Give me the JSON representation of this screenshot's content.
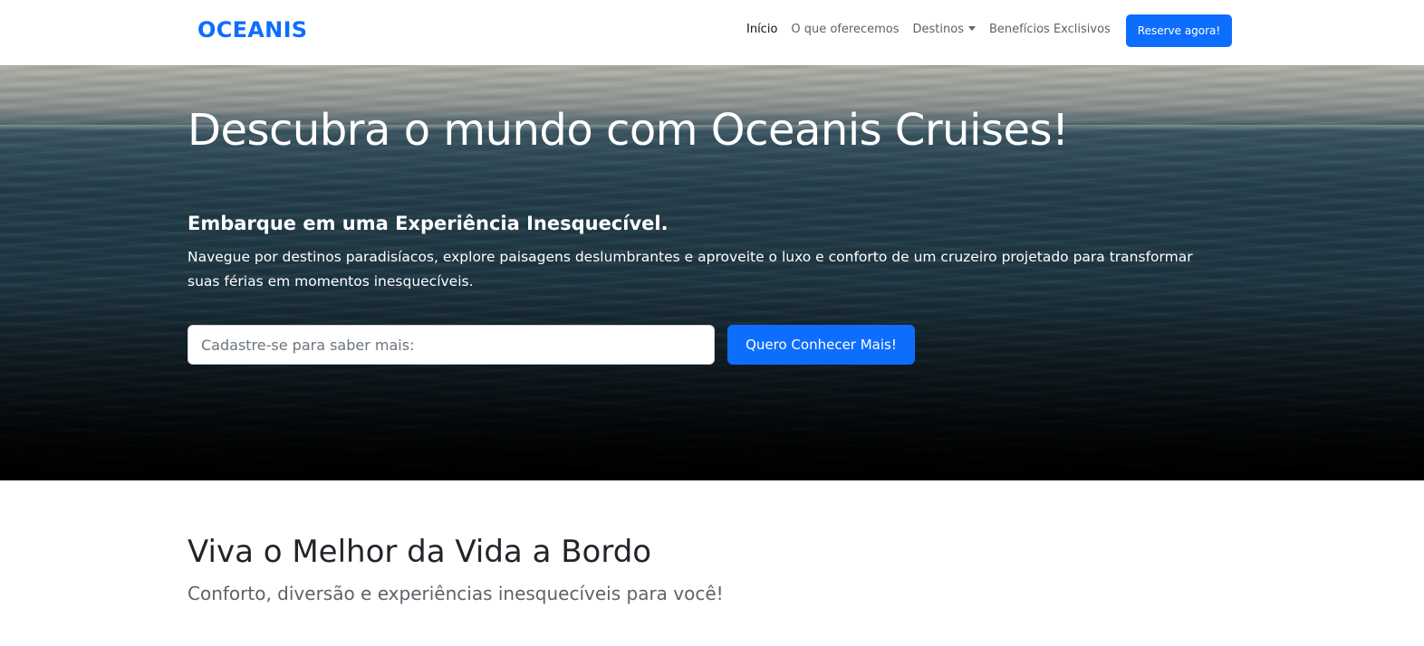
{
  "navbar": {
    "brand": "OCEANIS",
    "links": [
      {
        "label": "Início",
        "active": true
      },
      {
        "label": "O que oferecemos",
        "active": false
      },
      {
        "label": "Destinos",
        "active": false,
        "dropdown": true
      },
      {
        "label": "Benefícios Exclisivos",
        "active": false
      }
    ],
    "reserve_label": "Reserve agora!"
  },
  "hero": {
    "title": "Descubra o mundo com Oceanis Cruises!",
    "subtitle": "Embarque em uma Experiência Inesquecível.",
    "description": "Navegue por destinos paradisíacos, explore paisagens deslumbrantes e aproveite o luxo e conforto de um cruzeiro projetado para transformar suas férias em momentos inesquecíveis.",
    "input_placeholder": "Cadastre-se para saber mais:",
    "input_value": "",
    "cta_label": "Quero Conhecer Mais!"
  },
  "section": {
    "title": "Viva o Melhor da Vida a Bordo",
    "subtitle": "Conforto, diversão e experiências inesquecíveis para você!"
  },
  "colors": {
    "primary": "#0d6efd",
    "text_dark": "#212529",
    "text_muted": "#5c636a"
  }
}
